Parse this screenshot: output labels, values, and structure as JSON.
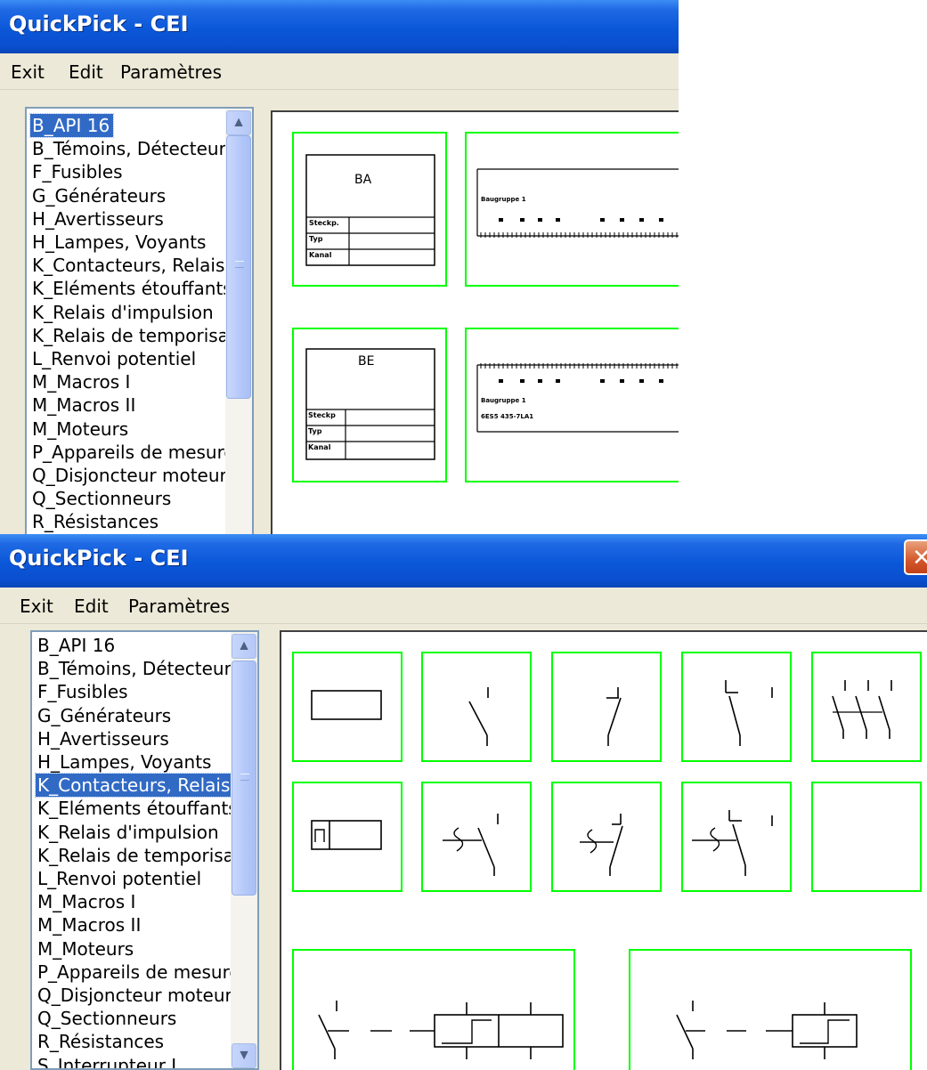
{
  "window": {
    "title": "QuickPick - CEI",
    "close_glyph": "✕",
    "menu": [
      "Exit",
      "Edit",
      "Paramètres"
    ]
  },
  "categories": [
    "B_API 16",
    "B_Témoins, Détecteur",
    "F_Fusibles",
    "G_Générateurs",
    "H_Avertisseurs",
    "H_Lampes, Voyants",
    "K_Contacteurs, Relais",
    "K_Eléments étouffants",
    "K_Relais d'impulsion",
    "K_Relais de temporisat",
    "L_Renvoi potentiel",
    "M_Macros I",
    "M_Macros II",
    "M_Moteurs",
    "P_Appareils de mesure",
    "Q_Disjoncteur moteur",
    "Q_Sectionneurs",
    "R_Résistances",
    "S_Interrupteur I"
  ],
  "screen1": {
    "selected_index": 0,
    "symbol_ba": {
      "name": "BA",
      "rows": [
        "Steckp.",
        "Typ",
        "Kanal"
      ]
    },
    "symbol_be": {
      "name": "BE",
      "rows": [
        "Steckp",
        "Typ",
        "Kanal"
      ]
    },
    "strip_top_label": "Baugruppe 1",
    "strip_bottom_label": "Baugruppe 1",
    "strip_bottom_sublabel": "6ES5 435-7LA1"
  },
  "screen2": {
    "selected_index": 6
  },
  "icons": {
    "scroll_up": "scroll-up-arrow-icon",
    "scroll_down": "scroll-down-arrow-icon"
  },
  "colors": {
    "titlebar": "#0a57d8",
    "selection": "#316ac5",
    "cell_border": "#00ff00",
    "window_bg": "#ece9d8"
  }
}
